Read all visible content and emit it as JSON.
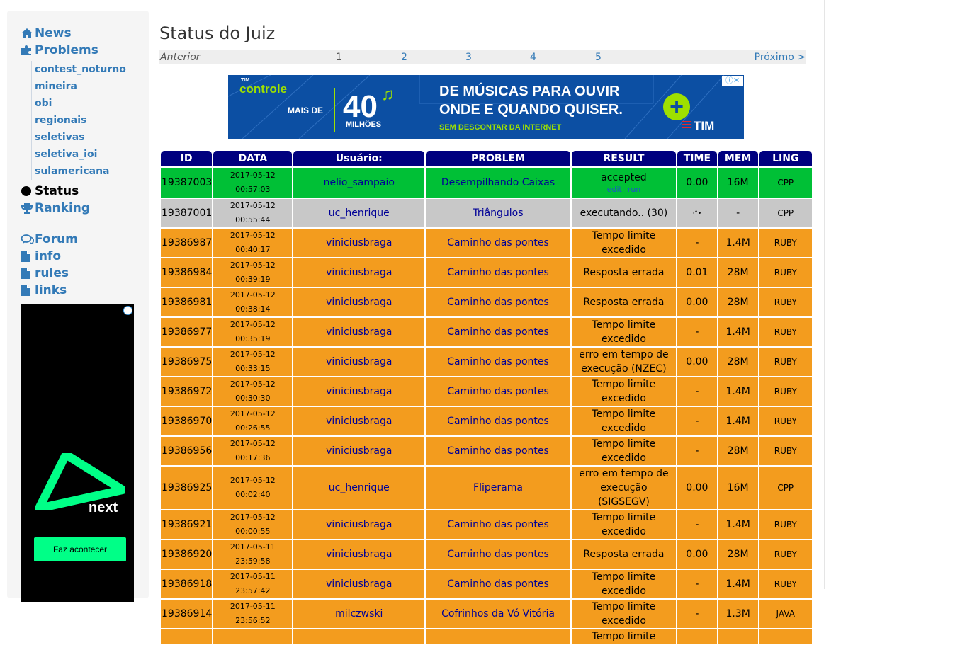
{
  "sidebar": {
    "nav": [
      {
        "label": "News",
        "icon": "home-icon"
      },
      {
        "label": "Problems",
        "icon": "puzzle-icon"
      }
    ],
    "problem_sets": [
      "contest_noturno",
      "mineira",
      "obi",
      "regionais",
      "seletivas",
      "seletiva_ioi",
      "sulamericana"
    ],
    "nav2": [
      {
        "label": "Status",
        "icon": "status-dot-icon"
      },
      {
        "label": "Ranking",
        "icon": "trophy-icon"
      }
    ],
    "nav3": [
      {
        "label": "Forum",
        "icon": "comments-icon"
      },
      {
        "label": "info",
        "icon": "file-icon"
      },
      {
        "label": "rules",
        "icon": "file-icon"
      },
      {
        "label": "links",
        "icon": "file-icon"
      }
    ],
    "ad": {
      "brand": "next",
      "cta": "Faz acontecer"
    }
  },
  "main": {
    "title": "Status do Juiz",
    "pager": {
      "prev": "Anterior",
      "pages": [
        "1",
        "2",
        "3",
        "4",
        "5"
      ],
      "current": "1",
      "next": "Próximo >"
    },
    "banner": {
      "brand": "controle",
      "brand_small": "TIM",
      "mais_de": "MAIS DE",
      "number": "40",
      "milhoes": "MILHÕES",
      "headline1": "DE MÚSICAS PARA OUVIR",
      "headline2": "ONDE E QUANDO QUISER.",
      "subline": "SEM DESCONTAR DA INTERNET",
      "plus": "+",
      "operator": "TIM"
    },
    "table": {
      "headers": [
        "ID",
        "DATA",
        "Usuário:",
        "PROBLEM",
        "RESULT",
        "TIME",
        "MEM",
        "LING"
      ],
      "accepted_links": [
        "edit",
        "run"
      ],
      "rows": [
        {
          "id": "19387003",
          "date": "2017-05-12 00:57:03",
          "user": "nelio_sampaio",
          "problem": "Desempilhando Caixas",
          "result": "accepted",
          "time": "0.00",
          "mem": "16M",
          "lang": "CPP",
          "status": "acc"
        },
        {
          "id": "19387001",
          "date": "2017-05-12 00:55:44",
          "user": "uc_henrique",
          "problem": "Triângulos",
          "result": "executando.. (30)",
          "time": "",
          "mem": "-",
          "lang": "CPP",
          "status": "pend"
        },
        {
          "id": "19386987",
          "date": "2017-05-12 00:40:17",
          "user": "viniciusbraga",
          "problem": "Caminho das pontes",
          "result": "Tempo limite excedido",
          "time": "-",
          "mem": "1.4M",
          "lang": "RUBY",
          "status": "err"
        },
        {
          "id": "19386984",
          "date": "2017-05-12 00:39:19",
          "user": "viniciusbraga",
          "problem": "Caminho das pontes",
          "result": "Resposta errada",
          "time": "0.01",
          "mem": "28M",
          "lang": "RUBY",
          "status": "err"
        },
        {
          "id": "19386981",
          "date": "2017-05-12 00:38:14",
          "user": "viniciusbraga",
          "problem": "Caminho das pontes",
          "result": "Resposta errada",
          "time": "0.00",
          "mem": "28M",
          "lang": "RUBY",
          "status": "err"
        },
        {
          "id": "19386977",
          "date": "2017-05-12 00:35:19",
          "user": "viniciusbraga",
          "problem": "Caminho das pontes",
          "result": "Tempo limite excedido",
          "time": "-",
          "mem": "1.4M",
          "lang": "RUBY",
          "status": "err"
        },
        {
          "id": "19386975",
          "date": "2017-05-12 00:33:15",
          "user": "viniciusbraga",
          "problem": "Caminho das pontes",
          "result": "erro em tempo de execução (NZEC)",
          "time": "0.00",
          "mem": "28M",
          "lang": "RUBY",
          "status": "err"
        },
        {
          "id": "19386972",
          "date": "2017-05-12 00:30:30",
          "user": "viniciusbraga",
          "problem": "Caminho das pontes",
          "result": "Tempo limite excedido",
          "time": "-",
          "mem": "1.4M",
          "lang": "RUBY",
          "status": "err"
        },
        {
          "id": "19386970",
          "date": "2017-05-12 00:26:55",
          "user": "viniciusbraga",
          "problem": "Caminho das pontes",
          "result": "Tempo limite excedido",
          "time": "-",
          "mem": "1.4M",
          "lang": "RUBY",
          "status": "err"
        },
        {
          "id": "19386956",
          "date": "2017-05-12 00:17:36",
          "user": "viniciusbraga",
          "problem": "Caminho das pontes",
          "result": "Tempo limite excedido",
          "time": "-",
          "mem": "28M",
          "lang": "RUBY",
          "status": "err"
        },
        {
          "id": "19386925",
          "date": "2017-05-12 00:02:40",
          "user": "uc_henrique",
          "problem": "Fliperama",
          "result": "erro em tempo de execução (SIGSEGV)",
          "time": "0.00",
          "mem": "16M",
          "lang": "CPP",
          "status": "err"
        },
        {
          "id": "19386921",
          "date": "2017-05-12 00:00:55",
          "user": "viniciusbraga",
          "problem": "Caminho das pontes",
          "result": "Tempo limite excedido",
          "time": "-",
          "mem": "1.4M",
          "lang": "RUBY",
          "status": "err"
        },
        {
          "id": "19386920",
          "date": "2017-05-11 23:59:58",
          "user": "viniciusbraga",
          "problem": "Caminho das pontes",
          "result": "Resposta errada",
          "time": "0.00",
          "mem": "28M",
          "lang": "RUBY",
          "status": "err"
        },
        {
          "id": "19386918",
          "date": "2017-05-11 23:57:42",
          "user": "viniciusbraga",
          "problem": "Caminho das pontes",
          "result": "Tempo limite excedido",
          "time": "-",
          "mem": "1.4M",
          "lang": "RUBY",
          "status": "err"
        },
        {
          "id": "19386914",
          "date": "2017-05-11 23:56:52",
          "user": "milczwski",
          "problem": "Cofrinhos da Vó Vitória",
          "result": "Tempo limite excedido",
          "time": "-",
          "mem": "1.3M",
          "lang": "JAVA",
          "status": "err"
        },
        {
          "id": "",
          "date": "",
          "user": "",
          "problem": "",
          "result": "Tempo limite",
          "time": "",
          "mem": "",
          "lang": "",
          "status": "err"
        }
      ]
    }
  }
}
